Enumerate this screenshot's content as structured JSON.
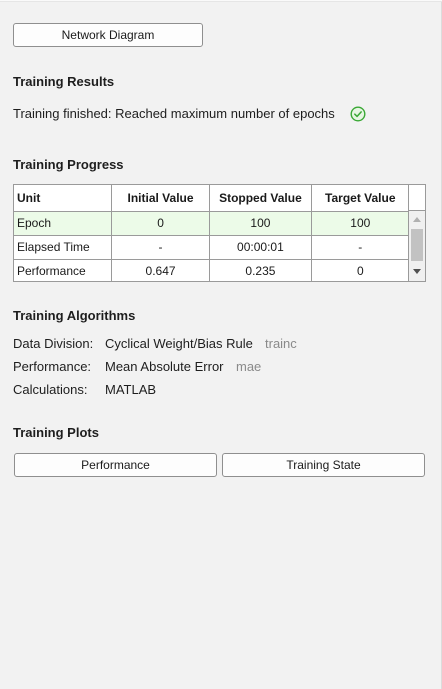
{
  "top_button": {
    "label": "Network Diagram"
  },
  "training_results": {
    "title": "Training Results",
    "status_text": "Training finished: Reached maximum number of epochs",
    "status_icon": "check-circle-icon",
    "status_color": "#3aa835"
  },
  "training_progress": {
    "title": "Training Progress",
    "columns": [
      "Unit",
      "Initial Value",
      "Stopped Value",
      "Target Value"
    ],
    "rows": [
      {
        "unit": "Epoch",
        "initial": "0",
        "stopped": "100",
        "target": "100"
      },
      {
        "unit": "Elapsed Time",
        "initial": "-",
        "stopped": "00:00:01",
        "target": "-"
      },
      {
        "unit": "Performance",
        "initial": "0.647",
        "stopped": "0.235",
        "target": "0"
      }
    ],
    "selected_row_color": "#ecfbe8"
  },
  "training_algorithms": {
    "title": "Training Algorithms",
    "items": [
      {
        "label": "Data Division:",
        "value": "Cyclical Weight/Bias Rule",
        "code": "trainc"
      },
      {
        "label": "Performance:",
        "value": "Mean Absolute Error",
        "code": "mae"
      },
      {
        "label": "Calculations:",
        "value": "MATLAB",
        "code": ""
      }
    ]
  },
  "training_plots": {
    "title": "Training Plots",
    "buttons": [
      "Performance",
      "Training State"
    ]
  }
}
